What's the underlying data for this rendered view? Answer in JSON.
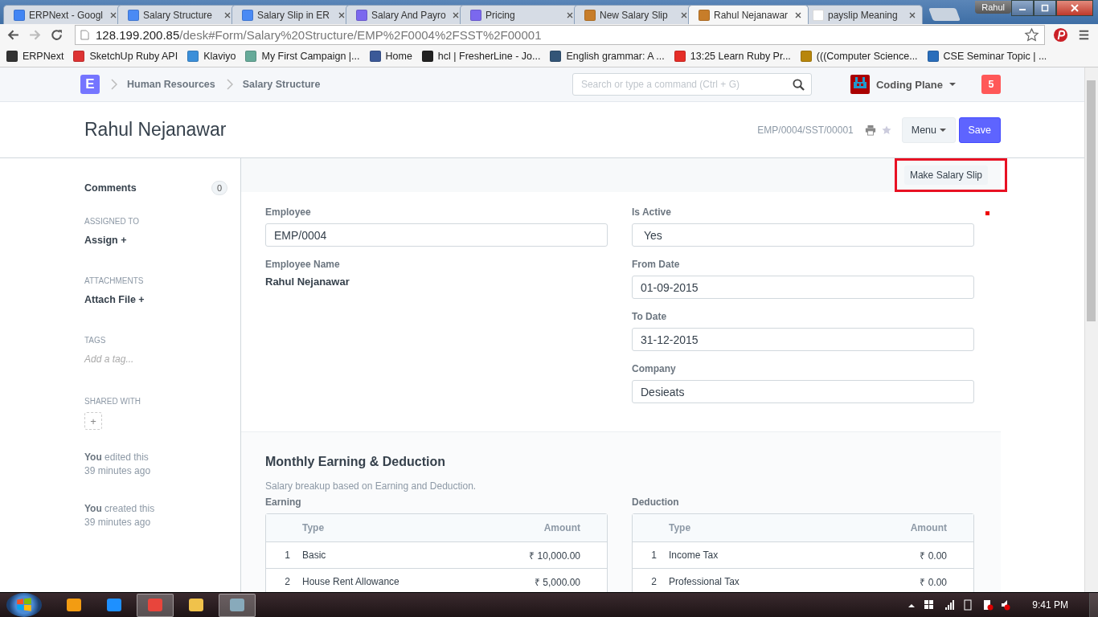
{
  "browser": {
    "tabs": [
      {
        "title": "ERPNext - Googl",
        "selected": false
      },
      {
        "title": "Salary Structure",
        "selected": false
      },
      {
        "title": "Salary Slip in ER",
        "selected": false
      },
      {
        "title": "Salary And Payro",
        "selected": false
      },
      {
        "title": "Pricing",
        "selected": false
      },
      {
        "title": "New Salary Slip",
        "selected": false
      },
      {
        "title": "Rahul Nejanawar",
        "selected": true
      },
      {
        "title": "payslip Meaning",
        "selected": false
      }
    ],
    "profile": "Rahul",
    "url_host": "128.199.200.85",
    "url_path": "/desk#Form/Salary%20Structure/EMP%2F0004%2FSST%2F00001",
    "bookmarks": [
      {
        "label": "ERPNext"
      },
      {
        "label": "SketchUp Ruby API"
      },
      {
        "label": "Klaviyo"
      },
      {
        "label": "My First Campaign |..."
      },
      {
        "label": "Home"
      },
      {
        "label": "hcl | FresherLine - Jo..."
      },
      {
        "label": "English grammar: A ..."
      },
      {
        "label": "13:25 Learn Ruby Pr..."
      },
      {
        "label": "(((Computer Science..."
      },
      {
        "label": "CSE Seminar Topic | ..."
      }
    ]
  },
  "navbar": {
    "logo": "E",
    "breadcrumbs": [
      "Human Resources",
      "Salary Structure"
    ],
    "search": {
      "placeholder": "Search or type a command (Ctrl + G)"
    },
    "user": "Coding Plane",
    "notifications": "5"
  },
  "page": {
    "title": "Rahul Nejanawar",
    "doc_id": "EMP/0004/SST/00001",
    "menu": "Menu",
    "save": "Save",
    "action": "Make Salary Slip"
  },
  "sidebar": {
    "comments": {
      "label": "Comments",
      "count": "0"
    },
    "assigned_label": "ASSIGNED TO",
    "assign": "Assign +",
    "attachments_label": "ATTACHMENTS",
    "attach": "Attach File +",
    "tags_label": "TAGS",
    "tag_placeholder": "Add a tag...",
    "shared_label": "SHARED WITH",
    "share_add": "+",
    "activity": [
      {
        "who": "You",
        "what": " edited this",
        "when": "39 minutes ago"
      },
      {
        "who": "You",
        "what": " created this",
        "when": "39 minutes ago"
      }
    ]
  },
  "form": {
    "left": [
      {
        "label": "Employee",
        "kind": "input",
        "value": "EMP/0004"
      },
      {
        "label": "Employee Name",
        "kind": "static",
        "value": "Rahul Nejanawar"
      }
    ],
    "right": [
      {
        "label": "Is Active",
        "kind": "select",
        "value": "Yes"
      },
      {
        "label": "From Date",
        "kind": "input",
        "value": "01-09-2015"
      },
      {
        "label": "To Date",
        "kind": "input",
        "value": "31-12-2015"
      },
      {
        "label": "Company",
        "kind": "input",
        "value": "Desieats"
      }
    ]
  },
  "section": {
    "title": "Monthly Earning & Deduction",
    "description": "Salary breakup based on Earning and Deduction.",
    "tables": [
      {
        "label": "Earning",
        "columns": [
          "Type",
          "Amount"
        ],
        "rows": [
          {
            "no": "1",
            "type": "Basic",
            "amount": "₹ 10,000.00"
          },
          {
            "no": "2",
            "type": "House Rent Allowance",
            "amount": "₹ 5,000.00"
          }
        ]
      },
      {
        "label": "Deduction",
        "columns": [
          "Type",
          "Amount"
        ],
        "rows": [
          {
            "no": "1",
            "type": "Income Tax",
            "amount": "₹ 0.00"
          },
          {
            "no": "2",
            "type": "Professional Tax",
            "amount": "₹ 0.00"
          }
        ]
      }
    ]
  },
  "taskbar": {
    "apps": [
      {
        "selected": false
      },
      {
        "selected": false
      },
      {
        "selected": true
      },
      {
        "selected": false
      },
      {
        "selected": true
      }
    ],
    "clock": "9:41 PM"
  }
}
